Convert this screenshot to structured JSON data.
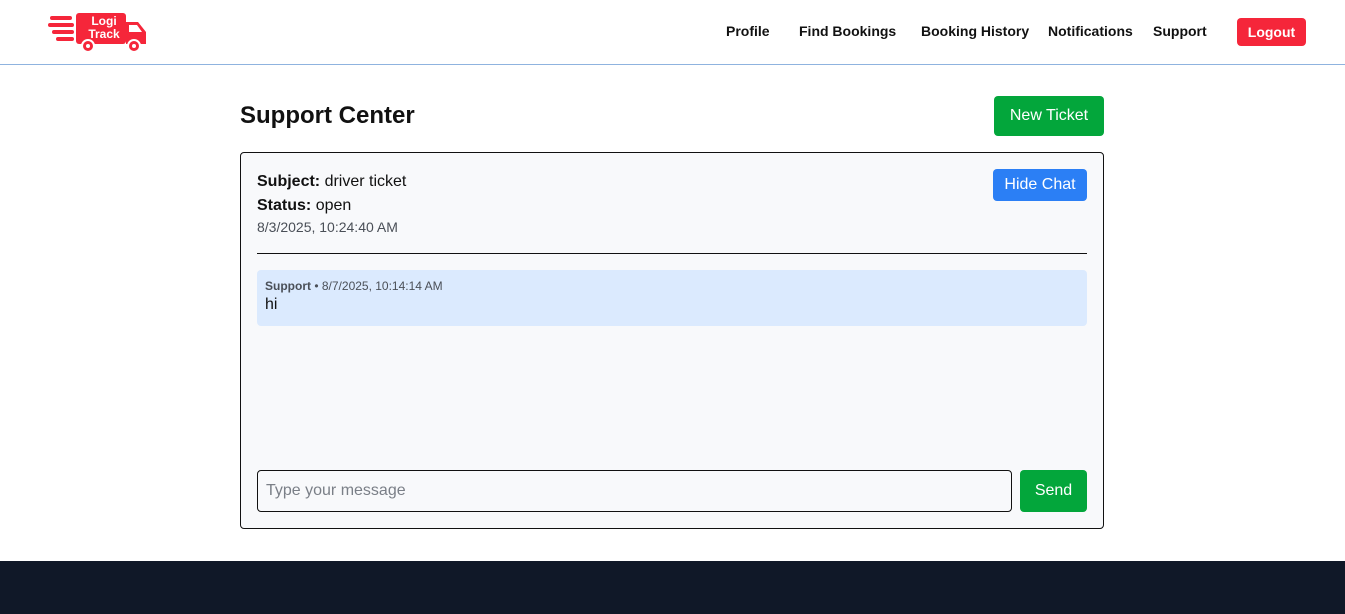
{
  "header": {
    "logo_text_line1": "Logi",
    "logo_text_line2": "Track",
    "nav": [
      {
        "label": "Profile"
      },
      {
        "label": "Find Bookings"
      },
      {
        "label": "Booking History"
      },
      {
        "label": "Notifications"
      },
      {
        "label": "Support"
      }
    ],
    "logout_label": "Logout"
  },
  "main": {
    "title": "Support Center",
    "new_ticket_label": "New Ticket",
    "ticket": {
      "subject_label": "Subject:",
      "subject": "driver ticket",
      "status_label": "Status:",
      "status": "open",
      "created": "8/3/2025, 10:24:40 AM",
      "hide_chat_label": "Hide Chat",
      "messages": [
        {
          "sender": "Support",
          "separator": " • ",
          "timestamp": "8/7/2025, 10:14:14 AM",
          "text": "hi"
        }
      ],
      "input_placeholder": "Type your message",
      "send_label": "Send"
    }
  },
  "colors": {
    "brand_red": "#f5263a",
    "success_green": "#03a63b",
    "primary_blue": "#2b7ff5",
    "message_bg": "#dbeafe",
    "footer_bg": "#101828"
  },
  "icons": {
    "logo": "delivery-truck-icon"
  }
}
